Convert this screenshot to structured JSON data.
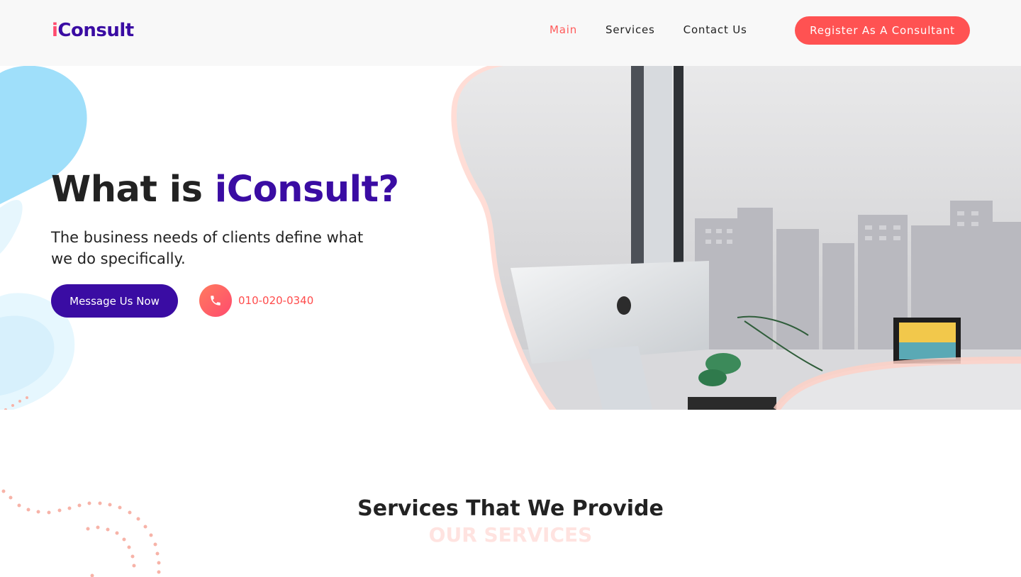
{
  "header": {
    "logo_first": "i",
    "logo_rest": "Consult",
    "nav": [
      {
        "label": "Main"
      },
      {
        "label": "Services"
      },
      {
        "label": "Contact Us"
      }
    ],
    "register_label": "Register As A Consultant"
  },
  "hero": {
    "title_prefix": "What is ",
    "title_brand": "iConsult?",
    "subtitle": "The business needs of clients define what we do specifically.",
    "message_button": "Message Us Now",
    "phone": "010-020-0340"
  },
  "services": {
    "title": "Services That We Provide",
    "subtitle": "OUR SERVICES"
  },
  "colors": {
    "accent": "#ff5252",
    "brand": "#3a0ca3",
    "light_blue": "#bfe8fb"
  },
  "icons": {
    "phone": "phone-icon"
  }
}
